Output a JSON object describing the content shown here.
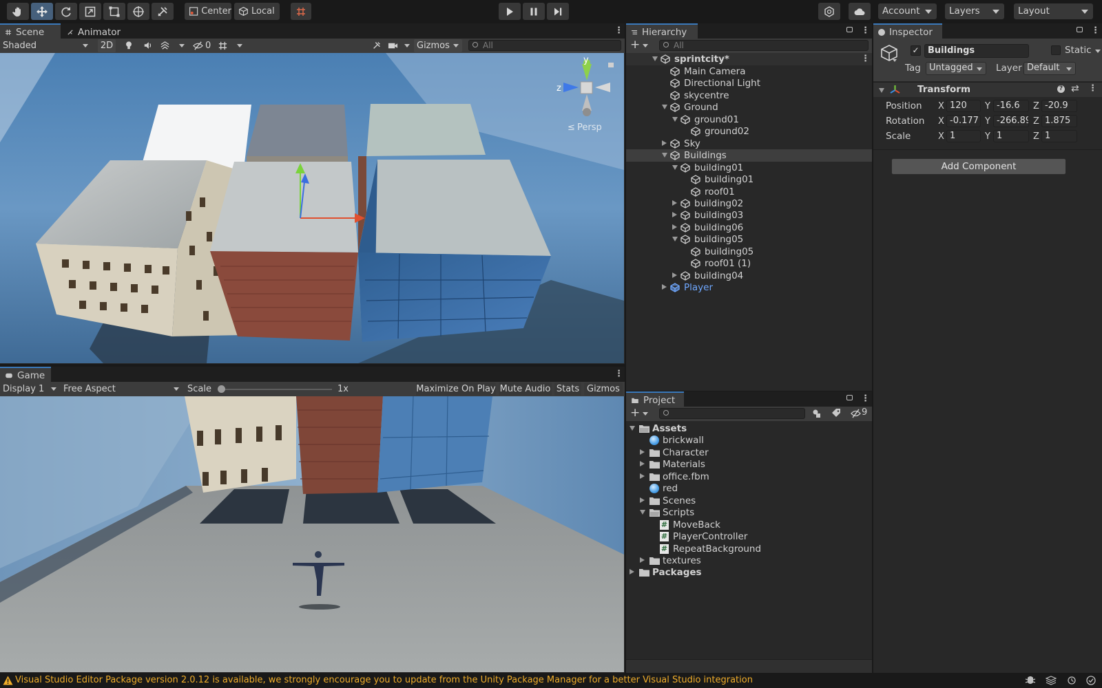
{
  "toolbar": {
    "pivot_label": "Center",
    "space_label": "Local",
    "account_label": "Account",
    "layers_label": "Layers",
    "layout_label": "Layout",
    "tools": [
      "hand-tool-icon",
      "move-tool-icon",
      "rotate-tool-icon",
      "scale-tool-icon",
      "rect-tool-icon",
      "transform-tool-icon",
      "custom-tool-icon"
    ]
  },
  "scene": {
    "tab_scene": "Scene",
    "tab_animator": "Animator",
    "draw_mode": "Shaded",
    "btn_2d": "2D",
    "hidden_count": "0",
    "gizmos_label": "Gizmos",
    "search_placeholder": "All",
    "gizmo_y": "y",
    "gizmo_z": "z",
    "persp_label": "Persp"
  },
  "game": {
    "tab_game": "Game",
    "display": "Display 1",
    "aspect": "Free Aspect",
    "scale_label": "Scale",
    "scale_value": "1x",
    "maximize": "Maximize On Play",
    "mute": "Mute Audio",
    "stats": "Stats",
    "gizmos": "Gizmos"
  },
  "hierarchy": {
    "tab": "Hierarchy",
    "search_placeholder": "All",
    "scene_name": "sprintcity*",
    "rows": [
      {
        "label": "Main Camera",
        "depth": 0,
        "expander": "none"
      },
      {
        "label": "Directional Light",
        "depth": 0,
        "expander": "none"
      },
      {
        "label": "skycentre",
        "depth": 0,
        "expander": "none"
      },
      {
        "label": "Ground",
        "depth": 0,
        "expander": "open"
      },
      {
        "label": "ground01",
        "depth": 1,
        "expander": "open"
      },
      {
        "label": "ground02",
        "depth": 2,
        "expander": "none"
      },
      {
        "label": "Sky",
        "depth": 0,
        "expander": "closed"
      },
      {
        "label": "Buildings",
        "depth": 0,
        "expander": "open",
        "selected": true
      },
      {
        "label": "building01",
        "depth": 1,
        "expander": "open"
      },
      {
        "label": "building01",
        "depth": 2,
        "expander": "none"
      },
      {
        "label": "roof01",
        "depth": 2,
        "expander": "none"
      },
      {
        "label": "building02",
        "depth": 1,
        "expander": "closed"
      },
      {
        "label": "building03",
        "depth": 1,
        "expander": "closed"
      },
      {
        "label": "building06",
        "depth": 1,
        "expander": "closed"
      },
      {
        "label": "building05",
        "depth": 1,
        "expander": "open"
      },
      {
        "label": "building05",
        "depth": 2,
        "expander": "none"
      },
      {
        "label": "roof01 (1)",
        "depth": 2,
        "expander": "none"
      },
      {
        "label": "building04",
        "depth": 1,
        "expander": "closed"
      },
      {
        "label": "Player",
        "depth": 0,
        "expander": "closed",
        "prefab": true
      }
    ]
  },
  "inspector": {
    "tab": "Inspector",
    "object_name": "Buildings",
    "static_label": "Static",
    "tag_label": "Tag",
    "tag_value": "Untagged",
    "layer_label": "Layer",
    "layer_value": "Default",
    "component_title": "Transform",
    "position_label": "Position",
    "rotation_label": "Rotation",
    "scale_label": "Scale",
    "axis_x": "X",
    "axis_y": "Y",
    "axis_z": "Z",
    "position": {
      "x": "120",
      "y": "-16.6",
      "z": "-20.9"
    },
    "rotation": {
      "x": "-0.177",
      "y": "-266.89",
      "z": "1.875"
    },
    "scale": {
      "x": "1",
      "y": "1",
      "z": "1"
    },
    "add_component": "Add Component"
  },
  "project": {
    "tab": "Project",
    "hidden_count": "9",
    "items": [
      {
        "label": "Assets",
        "depth": 0,
        "kind": "folder-open",
        "expander": "open",
        "bold": true
      },
      {
        "label": "brickwall",
        "depth": 1,
        "kind": "material",
        "expander": "none"
      },
      {
        "label": "Character",
        "depth": 1,
        "kind": "folder",
        "expander": "closed"
      },
      {
        "label": "Materials",
        "depth": 1,
        "kind": "folder",
        "expander": "closed"
      },
      {
        "label": "office.fbm",
        "depth": 1,
        "kind": "folder",
        "expander": "closed"
      },
      {
        "label": "red",
        "depth": 1,
        "kind": "material",
        "expander": "none"
      },
      {
        "label": "Scenes",
        "depth": 1,
        "kind": "folder",
        "expander": "closed"
      },
      {
        "label": "Scripts",
        "depth": 1,
        "kind": "folder-open",
        "expander": "open"
      },
      {
        "label": "MoveBack",
        "depth": 2,
        "kind": "script",
        "expander": "none"
      },
      {
        "label": "PlayerController",
        "depth": 2,
        "kind": "script",
        "expander": "none"
      },
      {
        "label": "RepeatBackground",
        "depth": 2,
        "kind": "script",
        "expander": "none"
      },
      {
        "label": "textures",
        "depth": 1,
        "kind": "folder",
        "expander": "closed"
      },
      {
        "label": "Packages",
        "depth": 0,
        "kind": "folder",
        "expander": "closed",
        "bold": true
      }
    ]
  },
  "status": {
    "message": "Visual Studio Editor Package version 2.0.12 is available, we strongly encourage you to update from the Unity Package Manager for a better Visual Studio integration"
  },
  "colors": {
    "accent": "#3a79bb",
    "warning": "#f0ad2a",
    "prefab": "#6fa8ff"
  }
}
